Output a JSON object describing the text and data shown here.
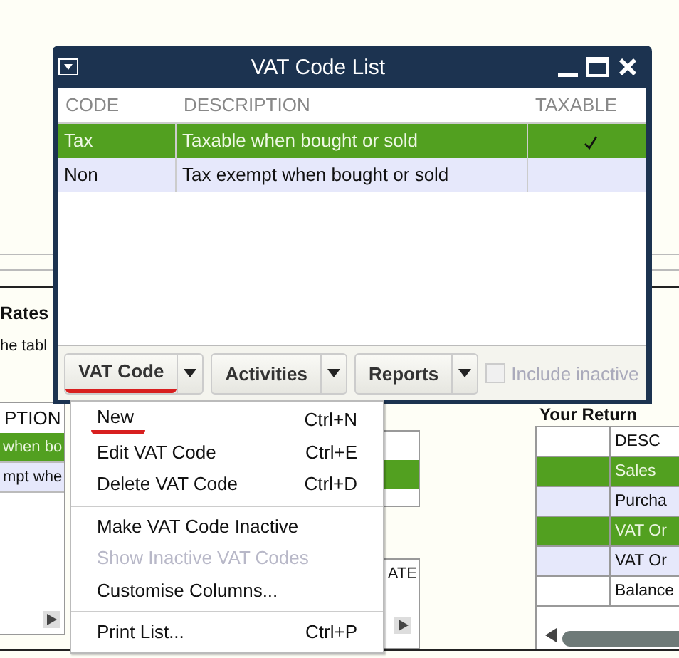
{
  "background": {
    "heading": "Rates",
    "note": "he tabl",
    "left_table": {
      "header": "PTION",
      "rows": [
        {
          "text": "when bo",
          "selected": true
        },
        {
          "text": "mpt whe",
          "selected": false
        }
      ]
    },
    "rate_table": {
      "header": "ATE"
    },
    "return_title": "Your Return",
    "return_table": {
      "header": "DESC",
      "rows": [
        {
          "kind": "line",
          "text": "Sales",
          "selected": true
        },
        {
          "kind": "line",
          "text": "Purcha",
          "selected": false
        },
        {
          "kind": "line",
          "text": "VAT Or",
          "selected": true
        },
        {
          "kind": "line",
          "text": "VAT Or",
          "selected": false
        },
        {
          "kind": "total",
          "text": "Balance",
          "selected": false
        }
      ]
    }
  },
  "window": {
    "title": "VAT Code List",
    "columns": [
      "CODE",
      "DESCRIPTION",
      "TAXABLE"
    ],
    "rows": [
      {
        "code": "Tax",
        "description": "Taxable when bought or sold",
        "taxable": true,
        "selected": true
      },
      {
        "code": "Non",
        "description": "Tax exempt when bought or sold",
        "taxable": false,
        "selected": false
      }
    ],
    "buttons": [
      {
        "label": "VAT Code",
        "marked": true
      },
      {
        "label": "Activities",
        "marked": false
      },
      {
        "label": "Reports",
        "marked": false
      }
    ],
    "include_inactive": {
      "label": "Include inactive",
      "checked": false,
      "disabled": true
    }
  },
  "menu": [
    {
      "kind": "item",
      "label": "New",
      "shortcut": "Ctrl+N",
      "disabled": false,
      "marked": true
    },
    {
      "kind": "item",
      "label": "Edit VAT Code",
      "shortcut": "Ctrl+E",
      "disabled": false,
      "marked": false
    },
    {
      "kind": "item",
      "label": "Delete VAT Code",
      "shortcut": "Ctrl+D",
      "disabled": false,
      "marked": false
    },
    {
      "kind": "separator"
    },
    {
      "kind": "item",
      "label": "Make VAT Code Inactive",
      "disabled": false,
      "marked": false
    },
    {
      "kind": "item",
      "label": "Show Inactive VAT Codes",
      "disabled": true,
      "marked": false
    },
    {
      "kind": "item",
      "label": "Customise Columns...",
      "disabled": false,
      "marked": false
    },
    {
      "kind": "separator"
    },
    {
      "kind": "item",
      "label": "Print List...",
      "shortcut": "Ctrl+P",
      "disabled": false,
      "marked": false
    }
  ]
}
